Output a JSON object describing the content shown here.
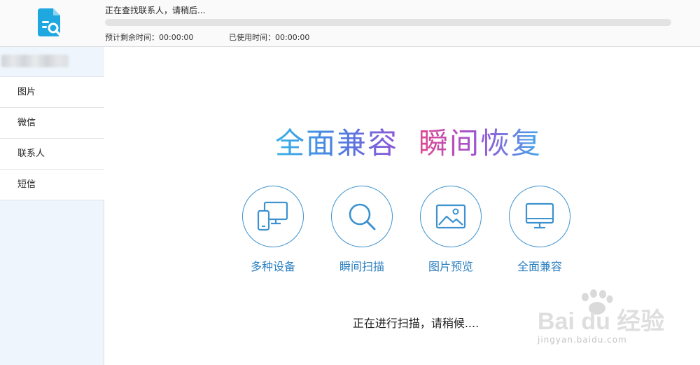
{
  "header": {
    "status": "正在查找联系人，请稍后...",
    "progress": 0,
    "estimated_time": "预计剩余时间：00:00:00",
    "used_time": "已使用时间：00:00:00"
  },
  "sidebar": {
    "items": [
      {
        "label": "图片"
      },
      {
        "label": "微信"
      },
      {
        "label": "联系人"
      },
      {
        "label": "短信"
      }
    ]
  },
  "main": {
    "slogan": [
      "全面兼容",
      "瞬间恢复"
    ],
    "features": [
      {
        "label": "多种设备",
        "icon": "devices-icon"
      },
      {
        "label": "瞬间扫描",
        "icon": "search-icon"
      },
      {
        "label": "图片预览",
        "icon": "image-icon"
      },
      {
        "label": "全面兼容",
        "icon": "monitor-icon"
      }
    ],
    "scan_message": "正在进行扫描，请稍候...."
  },
  "watermark": {
    "brand": "Bai du 经验",
    "url": "jingyan.baidu.com"
  },
  "colors": {
    "accent": "#3d92cf",
    "logo": "#1fa8e0",
    "feature_text": "#2c7fc0"
  }
}
